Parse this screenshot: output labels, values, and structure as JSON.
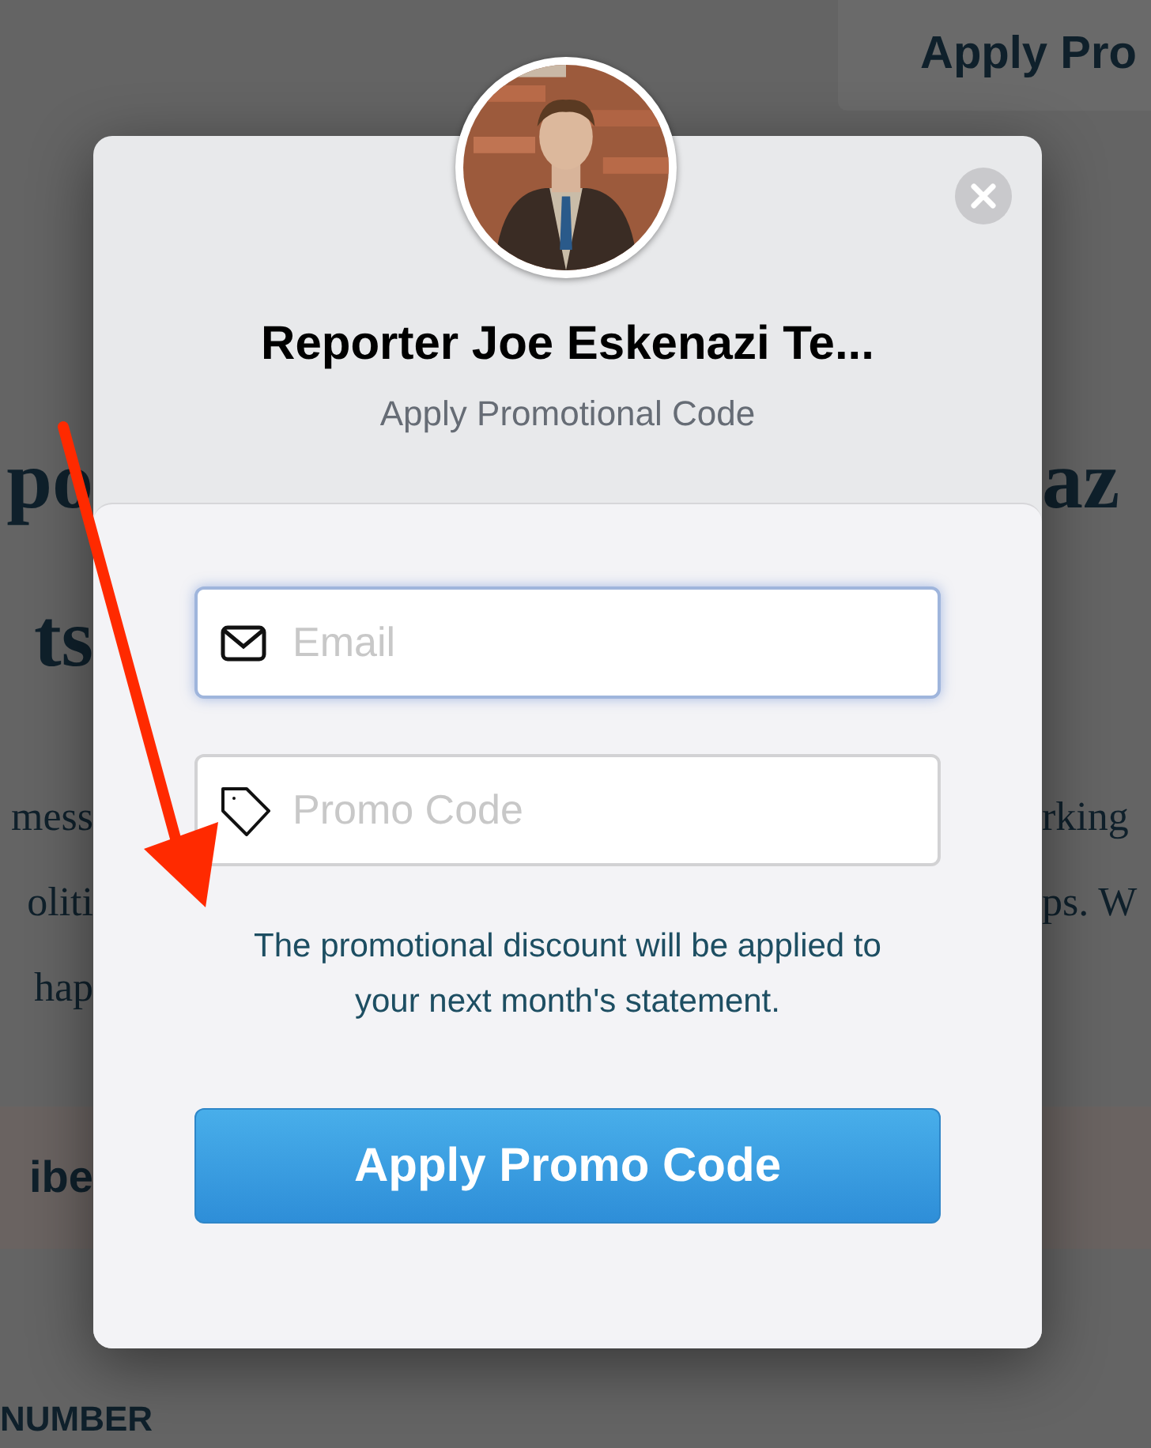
{
  "background": {
    "card_title": "Apply Pro",
    "left": {
      "headings": [
        "po",
        "ts"
      ],
      "body": [
        "mess",
        "oliti",
        "hap"
      ],
      "banner": "ibe"
    },
    "right": {
      "headings": [
        "az"
      ],
      "body": [
        "rking",
        "ps. W"
      ]
    },
    "footer_label": "NUMBER"
  },
  "dialog": {
    "title": "Reporter Joe Eskenazi Te...",
    "subtitle": "Apply Promotional Code",
    "fields": [
      {
        "kind": "email",
        "placeholder": "Email",
        "focused": true
      },
      {
        "kind": "promo",
        "placeholder": "Promo Code",
        "focused": false
      }
    ],
    "note": "The promotional discount will be applied to your next month's statement.",
    "button": "Apply Promo Code"
  }
}
